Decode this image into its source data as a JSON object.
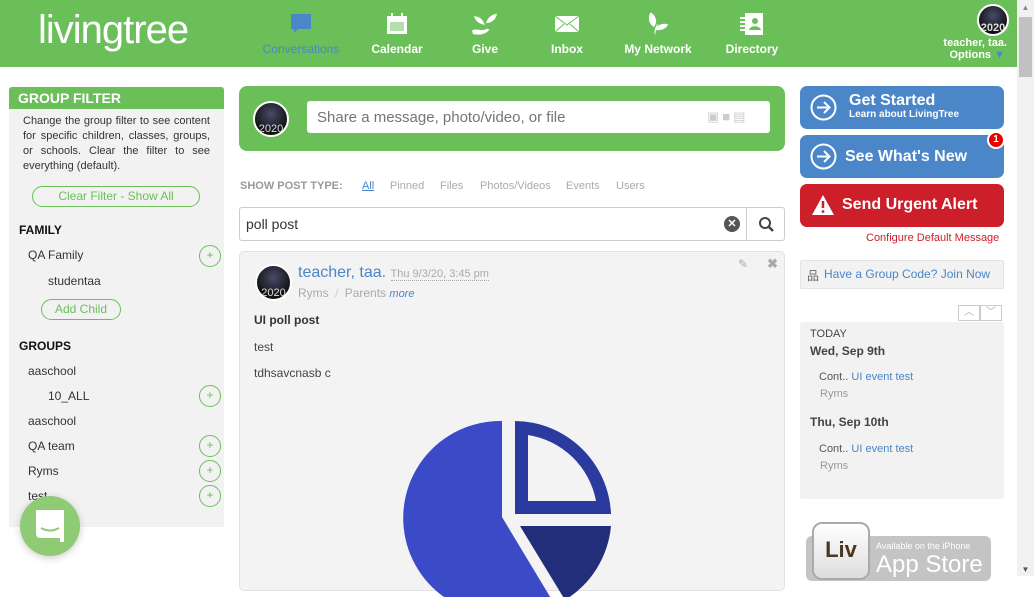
{
  "brand": {
    "logo_text": "livingtree",
    "green": "#6abf59",
    "blue": "#4a86c8",
    "red": "#cc1f2a"
  },
  "nav": [
    {
      "label": "Conversations",
      "icon": "chat-bubble-icon",
      "active": true
    },
    {
      "label": "Calendar",
      "icon": "calendar-icon"
    },
    {
      "label": "Give",
      "icon": "hand-plant-icon"
    },
    {
      "label": "Inbox",
      "icon": "envelope-icon"
    },
    {
      "label": "My Network",
      "icon": "leaves-icon"
    },
    {
      "label": "Directory",
      "icon": "contact-book-icon"
    }
  ],
  "user": {
    "name": "teacher, taa.",
    "options": "Options",
    "avatar_text": "2020"
  },
  "sidebar": {
    "title": "GROUP FILTER",
    "description": "Change the group filter to see content for specific children, classes, groups, or schools. Clear the filter to see everything (default).",
    "clear_filter": "Clear Filter - Show All",
    "family_heading": "FAMILY",
    "family": "QA Family",
    "child": "studentaa",
    "add_child": "Add Child",
    "groups_heading": "GROUPS",
    "groups": [
      "aaschool",
      "10_ALL",
      "aaschool",
      "QA team",
      "Ryms",
      "test"
    ]
  },
  "composer": {
    "placeholder": "Share a message, photo/video, or file"
  },
  "filters": {
    "label": "SHOW POST TYPE:",
    "types": [
      "All",
      "Pinned",
      "Files",
      "Photos/Videos",
      "Events",
      "Users"
    ],
    "active": "All"
  },
  "search": {
    "value": "poll post"
  },
  "post": {
    "author": "teacher, taa.",
    "timestamp": "Thu 9/3/20, 3:45 pm",
    "group": "Ryms",
    "separator": "/",
    "audience": "Parents",
    "more": "more",
    "title": "UI poll post",
    "lines": [
      "test",
      "tdhsavcnasb c"
    ]
  },
  "right": {
    "get_started": "Get Started",
    "get_started_sub": "Learn about LivingTree",
    "whats_new": "See What's New",
    "whats_new_badge": "1",
    "urgent": "Send Urgent Alert",
    "configure": "Configure Default Message",
    "group_code": "Have a Group Code? Join Now",
    "today": "TODAY",
    "days": [
      {
        "date": "Wed, Sep 9th",
        "prefix": "Cont..",
        "event": "UI event test",
        "group": "Ryms"
      },
      {
        "date": "Thu, Sep 10th",
        "prefix": "Cont..",
        "event": "UI event test",
        "group": "Ryms"
      }
    ],
    "appstore_small": "Available on the iPhone",
    "appstore_big": "App Store",
    "appstore_logo": "Liv"
  }
}
